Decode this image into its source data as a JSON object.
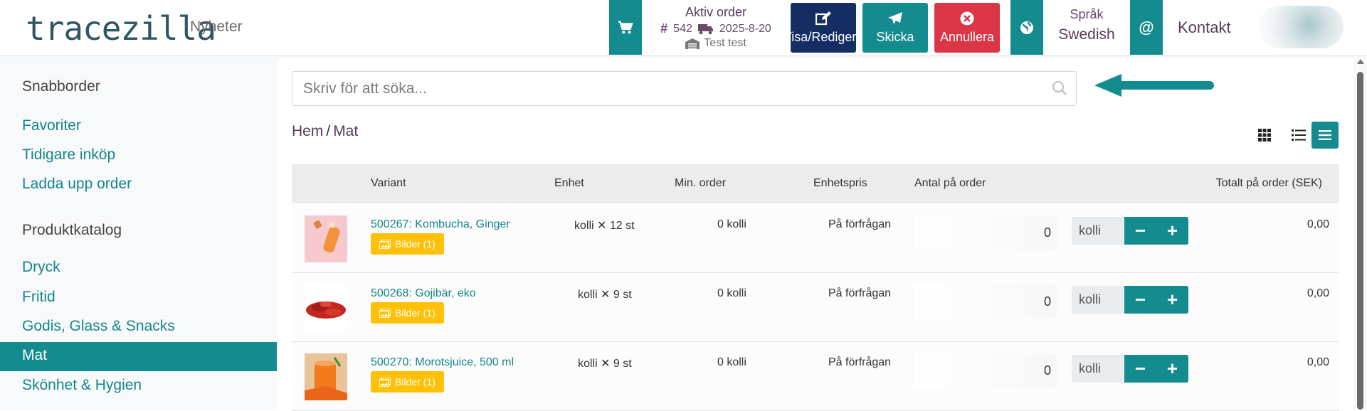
{
  "header": {
    "logo": "tracezilla",
    "nav_news": "Nyheter",
    "active_order": {
      "title": "Aktiv order",
      "order_number": "542",
      "delivery_date": "2025-8-20",
      "customer": "Test test"
    },
    "buttons": {
      "edit": "Visa/Redigera",
      "send": "Skicka",
      "cancel": "Annullera"
    },
    "language": {
      "label": "Språk",
      "value": "Swedish"
    },
    "contact": "Kontakt"
  },
  "sidebar": {
    "quick_order_heading": "Snabborder",
    "quick_links": [
      "Favoriter",
      "Tidigare inköp",
      "Ladda upp order"
    ],
    "catalog_heading": "Produktkatalog",
    "categories": [
      "Dryck",
      "Fritid",
      "Godis, Glass & Snacks",
      "Mat",
      "Skönhet & Hygien"
    ],
    "active_category": "Mat"
  },
  "search": {
    "placeholder": "Skriv för att söka..."
  },
  "breadcrumb": {
    "home": "Hem",
    "separator": "/",
    "current": "Mat"
  },
  "table": {
    "headers": {
      "variant": "Variant",
      "unit": "Enhet",
      "min_order": "Min. order",
      "unit_price": "Enhetspris",
      "qty_on_order": "Antal på order",
      "total_on_order": "Totalt på order (SEK)"
    },
    "rows": [
      {
        "name": "500267: Kombucha, Ginger",
        "images": "Bilder (1)",
        "unit_prefix": "kolli",
        "unit_suffix": "12 st",
        "min_order": "0 kolli",
        "price": "På förfrågan",
        "qty": "0",
        "qty_unit": "kolli",
        "total": "0,00"
      },
      {
        "name": "500268: Gojibär, eko",
        "images": "Bilder (1)",
        "unit_prefix": "kolli",
        "unit_suffix": "9 st",
        "min_order": "0 kolli",
        "price": "På förfrågan",
        "qty": "0",
        "qty_unit": "kolli",
        "total": "0,00"
      },
      {
        "name": "500270: Morotsjuice, 500 ml",
        "images": "Bilder (1)",
        "unit_prefix": "kolli",
        "unit_suffix": "9 st",
        "min_order": "0 kolli",
        "price": "På förfrågan",
        "qty": "0",
        "qty_unit": "kolli",
        "total": "0,00"
      }
    ]
  },
  "colors": {
    "teal": "#148b8e",
    "navy": "#142d63",
    "red": "#dc3545",
    "yellow": "#ffc107",
    "purple_text": "#5a3b5a"
  },
  "icons": [
    "cart-icon",
    "hash-icon",
    "truck-icon",
    "warehouse-icon",
    "edit-icon",
    "send-icon",
    "cancel-icon",
    "globe-icon",
    "at-icon",
    "search-icon",
    "arrow-left-icon",
    "grid-view-icon",
    "list-view-icon",
    "rows-view-icon",
    "images-icon",
    "times-icon"
  ]
}
